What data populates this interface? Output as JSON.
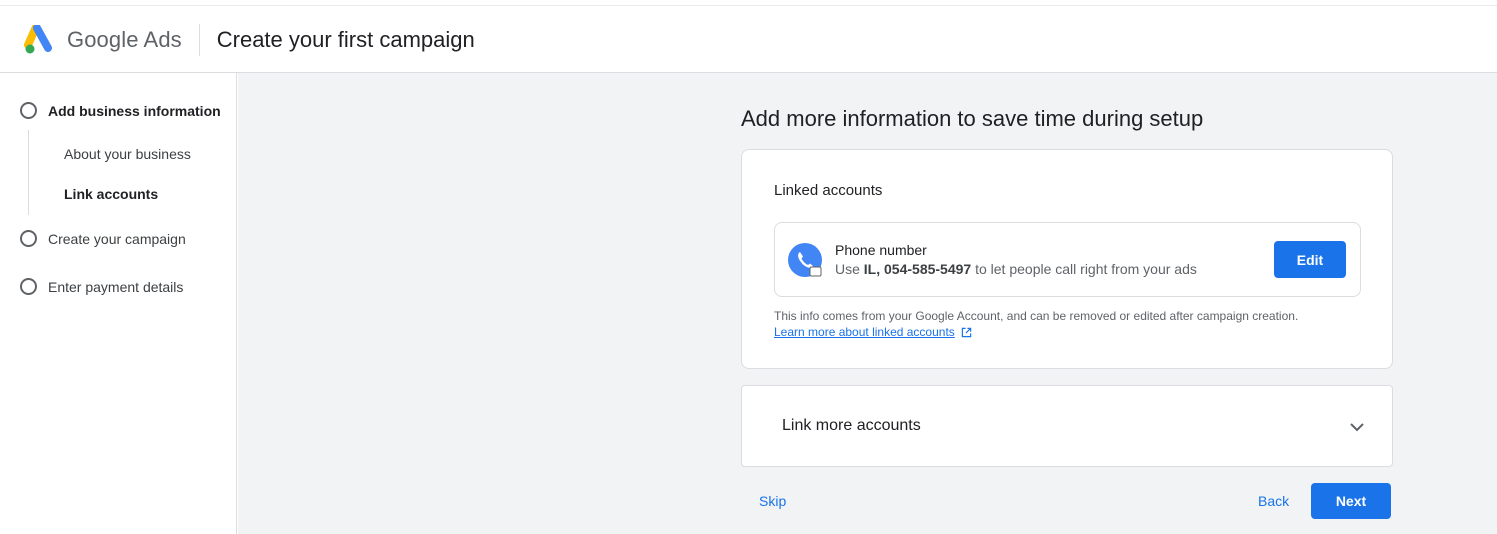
{
  "header": {
    "brand": "Google Ads",
    "title": "Create your first campaign"
  },
  "sidebar": {
    "steps": [
      {
        "label": "Add business information"
      },
      {
        "label": "Create your campaign"
      },
      {
        "label": "Enter payment details"
      }
    ],
    "substeps": [
      {
        "label": "About your business"
      },
      {
        "label": "Link accounts"
      }
    ]
  },
  "main": {
    "heading": "Add more information to save time during setup",
    "linked_accounts": {
      "title": "Linked accounts",
      "phone": {
        "title": "Phone number",
        "desc_prefix": "Use ",
        "number": "IL, 054-585-5497",
        "desc_suffix": " to let people call right from your ads",
        "edit_label": "Edit"
      },
      "info": "This info comes from your Google Account, and can be removed or edited after campaign creation.",
      "learn_more": "Learn more about linked accounts"
    },
    "link_more": {
      "title": "Link more accounts"
    },
    "footer": {
      "skip": "Skip",
      "back": "Back",
      "next": "Next"
    }
  },
  "colors": {
    "accent": "#1a73e8",
    "background": "#f1f3f4"
  }
}
